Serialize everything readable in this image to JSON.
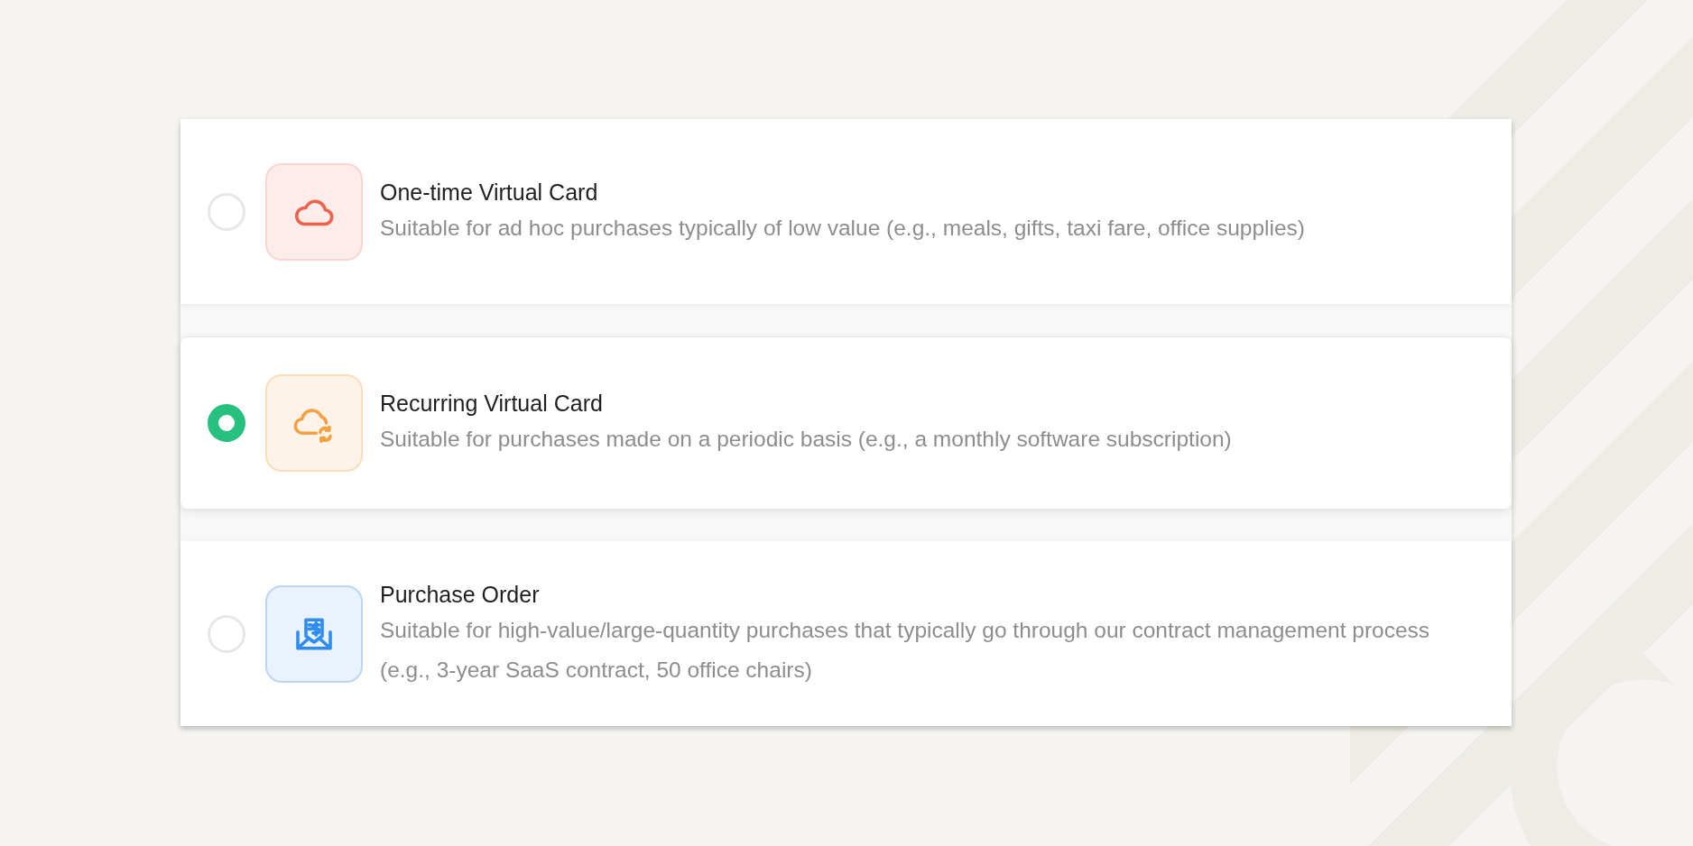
{
  "options": [
    {
      "kind": "one-time",
      "title": "One-time Virtual Card",
      "description": "Suitable for ad hoc purchases typically of low value (e.g., meals, gifts, taxi fare, office supplies)",
      "selected": false
    },
    {
      "kind": "recurring",
      "title": "Recurring Virtual Card",
      "description": "Suitable for purchases made on a periodic basis (e.g., a monthly software subscription)",
      "selected": true
    },
    {
      "kind": "purchase-order",
      "title": "Purchase Order",
      "description": "Suitable for high-value/large-quantity purchases that typically go through our contract management process (e.g., 3-year SaaS contract, 50 office chairs)",
      "selected": false
    }
  ]
}
